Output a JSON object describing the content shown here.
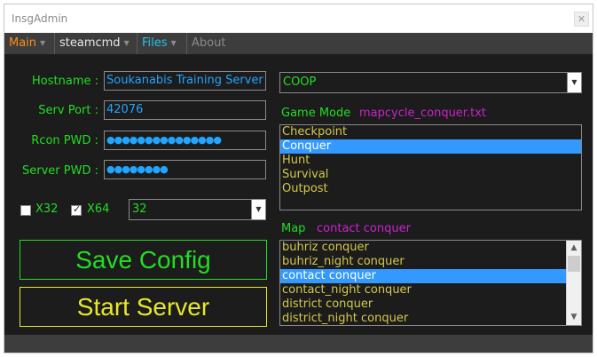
{
  "window": {
    "title": "InsgAdmin",
    "close_glyph": "✕"
  },
  "menu": {
    "main": "Main",
    "steamcmd": "steamcmd",
    "files": "Files",
    "about": "About"
  },
  "colors": {
    "label_green": "#22dd22",
    "input_blue": "#22a4ff",
    "accent_magenta": "#cc22cc",
    "list_yellow": "#d4c84a",
    "selection_blue": "#3399ff",
    "menu_orange": "#ff8c1a",
    "menu_cyan": "#22c4e8"
  },
  "settings": {
    "hostname_label": "Hostname :",
    "hostname_value": "Soukanabis Training Server",
    "port_label": "Serv Port :",
    "port_value": "42076",
    "rcon_label": "Rcon PWD :",
    "rcon_value": "●●●●●●●●●●●●●●●",
    "server_pwd_label": "Server PWD :",
    "server_pwd_value": "●●●●●●●●"
  },
  "arch": {
    "x32_label": "X32",
    "x32_checked": false,
    "x64_label": "X64",
    "x64_checked": true,
    "players_value": "32"
  },
  "buttons": {
    "save_config": "Save Config",
    "start_server": "Start Server"
  },
  "game": {
    "mode_combo": "COOP",
    "mode_label": "Game Mode",
    "mapcycle_file": "mapcycle_conquer.txt",
    "modes": [
      "Checkpoint",
      "Conquer",
      "Hunt",
      "Survival",
      "Outpost"
    ],
    "selected_mode": "Conquer"
  },
  "map": {
    "label": "Map",
    "current": "contact conquer",
    "maps": [
      "buhriz conquer",
      "buhriz_night conquer",
      "contact conquer",
      "contact_night conquer",
      "district conquer",
      "district_night conquer"
    ],
    "selected_map": "contact conquer"
  },
  "icons": {
    "combo_arrow": "▼",
    "scroll_up": "▲",
    "scroll_down": "▼",
    "menu_caret": "▼"
  }
}
